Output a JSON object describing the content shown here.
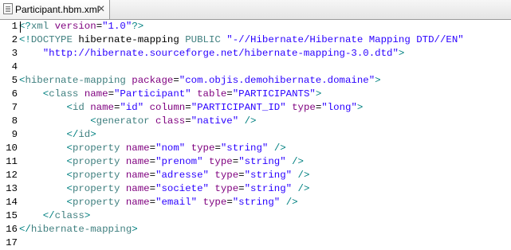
{
  "tab": {
    "label": "Participant.hbm.xml",
    "close_glyph": "✕",
    "icon": "xml-file-icon"
  },
  "colors": {
    "bracket": "#008080",
    "tag": "#3f7f7f",
    "attribute": "#7f007f",
    "value": "#2a00ff"
  },
  "lines": [
    {
      "n": "1",
      "tokens": [
        {
          "c": "t-decl",
          "t": "<?"
        },
        {
          "c": "t-tag",
          "t": "xml"
        },
        {
          "c": "t-text",
          "t": " "
        },
        {
          "c": "t-attr",
          "t": "version"
        },
        {
          "c": "t-text",
          "t": "="
        },
        {
          "c": "t-val",
          "t": "\"1.0\""
        },
        {
          "c": "t-decl",
          "t": "?>"
        }
      ]
    },
    {
      "n": "2",
      "tokens": [
        {
          "c": "t-bracket",
          "t": "<!"
        },
        {
          "c": "t-doctype",
          "t": "DOCTYPE"
        },
        {
          "c": "t-text",
          "t": " hibernate-mapping "
        },
        {
          "c": "t-doctype",
          "t": "PUBLIC"
        },
        {
          "c": "t-text",
          "t": " "
        },
        {
          "c": "t-val",
          "t": "\"-//Hibernate/Hibernate Mapping DTD//EN\""
        }
      ]
    },
    {
      "n": "3",
      "tokens": [
        {
          "c": "t-text",
          "t": "    "
        },
        {
          "c": "t-val",
          "t": "\"http://hibernate.sourceforge.net/hibernate-mapping-3.0.dtd\""
        },
        {
          "c": "t-bracket",
          "t": ">"
        }
      ]
    },
    {
      "n": "4",
      "tokens": []
    },
    {
      "n": "5",
      "tokens": [
        {
          "c": "t-bracket",
          "t": "<"
        },
        {
          "c": "t-tag",
          "t": "hibernate-mapping"
        },
        {
          "c": "t-text",
          "t": " "
        },
        {
          "c": "t-attr",
          "t": "package"
        },
        {
          "c": "t-text",
          "t": "="
        },
        {
          "c": "t-val",
          "t": "\"com.objis.demohibernate.domaine\""
        },
        {
          "c": "t-bracket",
          "t": ">"
        }
      ]
    },
    {
      "n": "6",
      "tokens": [
        {
          "c": "t-text",
          "t": "    "
        },
        {
          "c": "t-bracket",
          "t": "<"
        },
        {
          "c": "t-tag",
          "t": "class"
        },
        {
          "c": "t-text",
          "t": " "
        },
        {
          "c": "t-attr",
          "t": "name"
        },
        {
          "c": "t-text",
          "t": "="
        },
        {
          "c": "t-val",
          "t": "\"Participant\""
        },
        {
          "c": "t-text",
          "t": " "
        },
        {
          "c": "t-attr",
          "t": "table"
        },
        {
          "c": "t-text",
          "t": "="
        },
        {
          "c": "t-val",
          "t": "\"PARTICIPANTS\""
        },
        {
          "c": "t-bracket",
          "t": ">"
        }
      ]
    },
    {
      "n": "7",
      "tokens": [
        {
          "c": "t-text",
          "t": "        "
        },
        {
          "c": "t-bracket",
          "t": "<"
        },
        {
          "c": "t-tag",
          "t": "id"
        },
        {
          "c": "t-text",
          "t": " "
        },
        {
          "c": "t-attr",
          "t": "name"
        },
        {
          "c": "t-text",
          "t": "="
        },
        {
          "c": "t-val",
          "t": "\"id\""
        },
        {
          "c": "t-text",
          "t": " "
        },
        {
          "c": "t-attr",
          "t": "column"
        },
        {
          "c": "t-text",
          "t": "="
        },
        {
          "c": "t-val",
          "t": "\"PARTICIPANT_ID\""
        },
        {
          "c": "t-text",
          "t": " "
        },
        {
          "c": "t-attr",
          "t": "type"
        },
        {
          "c": "t-text",
          "t": "="
        },
        {
          "c": "t-val",
          "t": "\"long\""
        },
        {
          "c": "t-bracket",
          "t": ">"
        }
      ]
    },
    {
      "n": "8",
      "tokens": [
        {
          "c": "t-text",
          "t": "            "
        },
        {
          "c": "t-bracket",
          "t": "<"
        },
        {
          "c": "t-tag",
          "t": "generator"
        },
        {
          "c": "t-text",
          "t": " "
        },
        {
          "c": "t-attr",
          "t": "class"
        },
        {
          "c": "t-text",
          "t": "="
        },
        {
          "c": "t-val",
          "t": "\"native\""
        },
        {
          "c": "t-text",
          "t": " "
        },
        {
          "c": "t-bracket",
          "t": "/>"
        }
      ]
    },
    {
      "n": "9",
      "tokens": [
        {
          "c": "t-text",
          "t": "        "
        },
        {
          "c": "t-bracket",
          "t": "</"
        },
        {
          "c": "t-tag",
          "t": "id"
        },
        {
          "c": "t-bracket",
          "t": ">"
        }
      ]
    },
    {
      "n": "10",
      "tokens": [
        {
          "c": "t-text",
          "t": "        "
        },
        {
          "c": "t-bracket",
          "t": "<"
        },
        {
          "c": "t-tag",
          "t": "property"
        },
        {
          "c": "t-text",
          "t": " "
        },
        {
          "c": "t-attr",
          "t": "name"
        },
        {
          "c": "t-text",
          "t": "="
        },
        {
          "c": "t-val",
          "t": "\"nom\""
        },
        {
          "c": "t-text",
          "t": " "
        },
        {
          "c": "t-attr",
          "t": "type"
        },
        {
          "c": "t-text",
          "t": "="
        },
        {
          "c": "t-val",
          "t": "\"string\""
        },
        {
          "c": "t-text",
          "t": " "
        },
        {
          "c": "t-bracket",
          "t": "/>"
        }
      ]
    },
    {
      "n": "11",
      "tokens": [
        {
          "c": "t-text",
          "t": "        "
        },
        {
          "c": "t-bracket",
          "t": "<"
        },
        {
          "c": "t-tag",
          "t": "property"
        },
        {
          "c": "t-text",
          "t": " "
        },
        {
          "c": "t-attr",
          "t": "name"
        },
        {
          "c": "t-text",
          "t": "="
        },
        {
          "c": "t-val",
          "t": "\"prenom\""
        },
        {
          "c": "t-text",
          "t": " "
        },
        {
          "c": "t-attr",
          "t": "type"
        },
        {
          "c": "t-text",
          "t": "="
        },
        {
          "c": "t-val",
          "t": "\"string\""
        },
        {
          "c": "t-text",
          "t": " "
        },
        {
          "c": "t-bracket",
          "t": "/>"
        }
      ]
    },
    {
      "n": "12",
      "tokens": [
        {
          "c": "t-text",
          "t": "        "
        },
        {
          "c": "t-bracket",
          "t": "<"
        },
        {
          "c": "t-tag",
          "t": "property"
        },
        {
          "c": "t-text",
          "t": " "
        },
        {
          "c": "t-attr",
          "t": "name"
        },
        {
          "c": "t-text",
          "t": "="
        },
        {
          "c": "t-val",
          "t": "\"adresse\""
        },
        {
          "c": "t-text",
          "t": " "
        },
        {
          "c": "t-attr",
          "t": "type"
        },
        {
          "c": "t-text",
          "t": "="
        },
        {
          "c": "t-val",
          "t": "\"string\""
        },
        {
          "c": "t-text",
          "t": " "
        },
        {
          "c": "t-bracket",
          "t": "/>"
        }
      ]
    },
    {
      "n": "13",
      "tokens": [
        {
          "c": "t-text",
          "t": "        "
        },
        {
          "c": "t-bracket",
          "t": "<"
        },
        {
          "c": "t-tag",
          "t": "property"
        },
        {
          "c": "t-text",
          "t": " "
        },
        {
          "c": "t-attr",
          "t": "name"
        },
        {
          "c": "t-text",
          "t": "="
        },
        {
          "c": "t-val",
          "t": "\"societe\""
        },
        {
          "c": "t-text",
          "t": " "
        },
        {
          "c": "t-attr",
          "t": "type"
        },
        {
          "c": "t-text",
          "t": "="
        },
        {
          "c": "t-val",
          "t": "\"string\""
        },
        {
          "c": "t-text",
          "t": " "
        },
        {
          "c": "t-bracket",
          "t": "/>"
        }
      ]
    },
    {
      "n": "14",
      "tokens": [
        {
          "c": "t-text",
          "t": "        "
        },
        {
          "c": "t-bracket",
          "t": "<"
        },
        {
          "c": "t-tag",
          "t": "property"
        },
        {
          "c": "t-text",
          "t": " "
        },
        {
          "c": "t-attr",
          "t": "name"
        },
        {
          "c": "t-text",
          "t": "="
        },
        {
          "c": "t-val",
          "t": "\"email\""
        },
        {
          "c": "t-text",
          "t": " "
        },
        {
          "c": "t-attr",
          "t": "type"
        },
        {
          "c": "t-text",
          "t": "="
        },
        {
          "c": "t-val",
          "t": "\"string\""
        },
        {
          "c": "t-text",
          "t": " "
        },
        {
          "c": "t-bracket",
          "t": "/>"
        }
      ]
    },
    {
      "n": "15",
      "tokens": [
        {
          "c": "t-text",
          "t": "    "
        },
        {
          "c": "t-bracket",
          "t": "</"
        },
        {
          "c": "t-tag",
          "t": "class"
        },
        {
          "c": "t-bracket",
          "t": ">"
        }
      ]
    },
    {
      "n": "16",
      "tokens": [
        {
          "c": "t-bracket",
          "t": "</"
        },
        {
          "c": "t-tag",
          "t": "hibernate-mapping"
        },
        {
          "c": "t-bracket",
          "t": ">"
        }
      ]
    },
    {
      "n": "17",
      "tokens": []
    }
  ]
}
